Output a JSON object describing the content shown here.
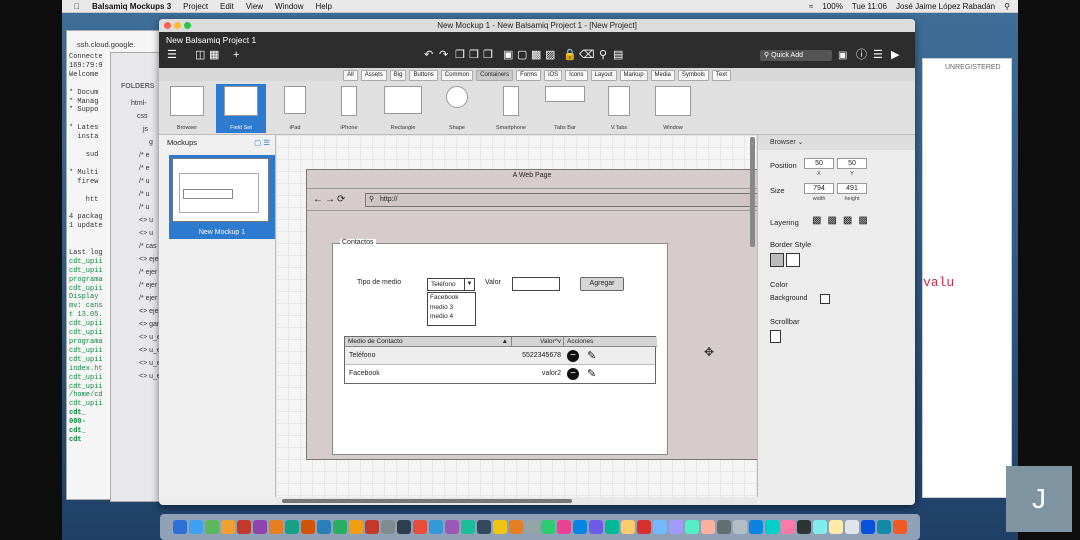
{
  "menubar": {
    "app": "Balsamiq Mockups 3",
    "items": [
      "Project",
      "Edit",
      "View",
      "Window",
      "Help"
    ],
    "battery": "100%",
    "clock": "Tue 11:06",
    "user": "José Jaime López Rabadán"
  },
  "ssh": {
    "title": "ssh.cloud.google.",
    "lines": [
      "Connecte",
      "169:79:9",
      "Welcome",
      "",
      "* Docum",
      "* Manag",
      "* Suppo",
      "",
      "* Lates",
      "  insta",
      "",
      "    sud",
      "",
      "* Multi",
      "  firew",
      "",
      "    htt",
      "",
      "4 packag",
      "1 update",
      "",
      "",
      "Last log"
    ],
    "green_lines": [
      "cdt_upii",
      "cdt_upii",
      "programa",
      "cdt_upii",
      "Display",
      "mv: cans",
      "t 13.05.",
      "cdt_upii",
      "cdt_upii",
      "programa",
      "cdt_upii",
      "cdt_upii",
      "index.ht",
      "cdt_upii",
      "cdt_upii",
      "/home/cd",
      "cdt_upii"
    ],
    "bottom_lines": [
      "cdt_",
      "000-",
      "cdt_",
      "cdt"
    ]
  },
  "finder": {
    "folders_label": "FOLDERS",
    "tree": [
      "html-",
      "css",
      "js",
      "g",
      "/* e",
      "/* e",
      "/* u",
      "/* u",
      "/* u",
      "<> u",
      "<> u",
      "/* cas",
      "<> ejer",
      "/* ejer",
      "/* ejer",
      "/* ejer",
      "<> ejer",
      "<> gan",
      "<> u_e",
      "<> u_e",
      "<> u_e",
      "<> u_e"
    ]
  },
  "right_bg": {
    "unregistered": "UNREGISTERED",
    "code_word": "valu"
  },
  "window": {
    "title": "New Mockup 1 - New Balsamiq Project 1 - [New Project]",
    "project_name": "New Balsamiq Project 1",
    "quick_add_placeholder": "Quick Add"
  },
  "filters": [
    "All",
    "Assets",
    "Big",
    "Buttons",
    "Common",
    "Containers",
    "Forms",
    "iOS",
    "Icons",
    "Layout",
    "Markup",
    "Media",
    "Symbols",
    "Text"
  ],
  "selected_filter": "Containers",
  "controls": [
    "Browser",
    "Field Set",
    "iPad",
    "iPhone",
    "Rectangle",
    "Shape",
    "Smartphone",
    "Tabs Bar",
    "V.Tabs",
    "Window"
  ],
  "selected_control": "Field Set",
  "mockups_panel": {
    "title": "Mockups",
    "items": [
      "New Mockup 1"
    ]
  },
  "mock": {
    "page_title": "A Web Page",
    "url": "http://",
    "legend": "Contactos",
    "tipo_label": "Tipo de medio",
    "tipo_value": "Teléfono",
    "options": [
      "Facebook",
      "medio 3",
      "medio 4"
    ],
    "valor_label": "Valor",
    "agregar": "Agregar",
    "table": {
      "headers": [
        "Medio de Contacto",
        "Valor^v",
        "Acciones"
      ],
      "rows": [
        {
          "medio": "Teléfono",
          "valor": "5522345678"
        },
        {
          "medio": "Facebook",
          "valor": "valor2"
        }
      ]
    }
  },
  "props": {
    "header": "Browser",
    "position_label": "Position",
    "x": "50",
    "y": "50",
    "x_sub": "X",
    "y_sub": "Y",
    "size_label": "Size",
    "width": "794",
    "height": "491",
    "w_sub": "width",
    "h_sub": "height",
    "layering_label": "Layering",
    "border_label": "Border Style",
    "color_label": "Color",
    "background_label": "Background",
    "scrollbar_label": "Scrollbar"
  },
  "user_tile": "J",
  "colors": {
    "selection": "#2c7bd1",
    "toolbar": "#2d2d2d",
    "mock_bg": "#d6cccc"
  }
}
